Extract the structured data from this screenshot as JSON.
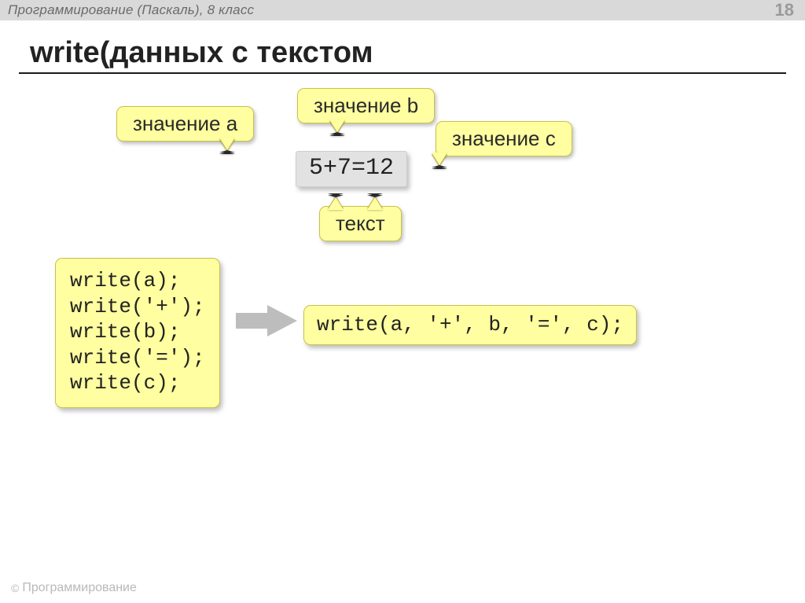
{
  "header": {
    "crumb": "Программирование (Паскаль), 8 класс",
    "page_number": "18"
  },
  "title": "write(данных с текстом",
  "callout": {
    "a": "значение a",
    "b": "значение b",
    "c": "значение c",
    "text": "текст"
  },
  "expression": "5+7=12",
  "code_left": "write(a);\nwrite('+');\nwrite(b);\nwrite('=');\nwrite(c);",
  "code_right": "write(a, '+', b, '=', c);",
  "footer": {
    "copy": "©",
    "text": "Программирование"
  }
}
